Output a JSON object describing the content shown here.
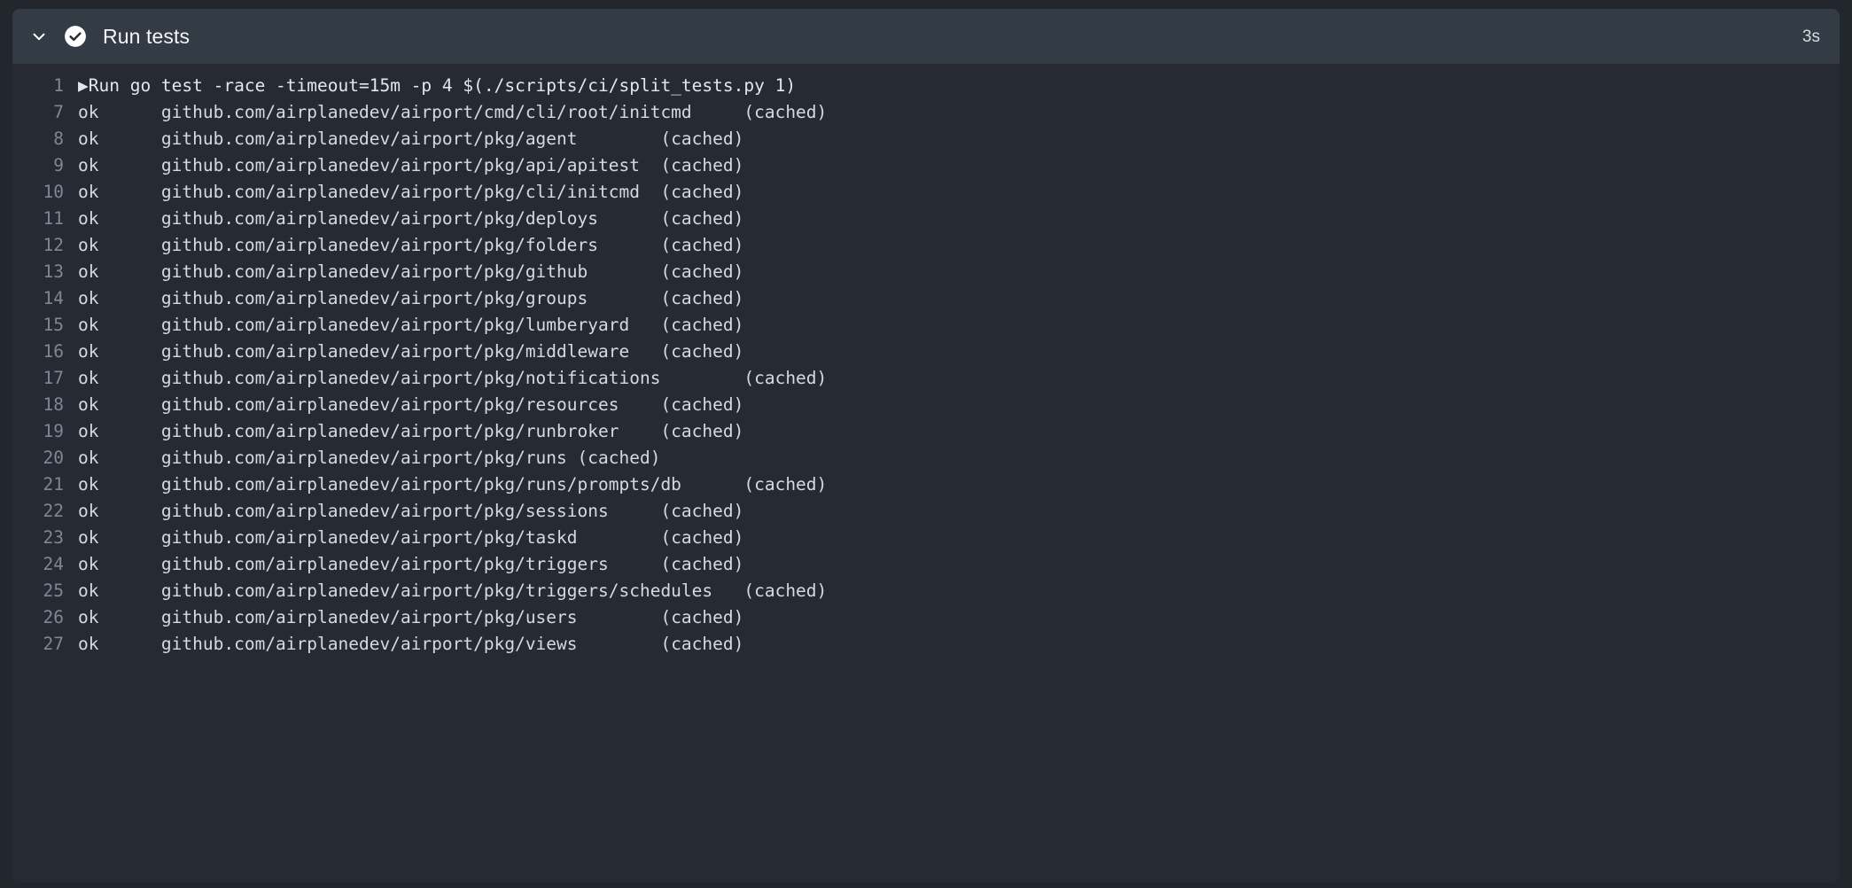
{
  "step": {
    "title": "Run tests",
    "duration": "3s",
    "status": "success",
    "collapse_icon": "chevron-down-icon",
    "status_icon": "check-circle-icon",
    "expanded": true
  },
  "colors": {
    "page_background": "#22262d",
    "header_background": "#333b45",
    "log_background": "#262b33",
    "text": "#d5dae1",
    "line_number": "#7d8795",
    "title": "#f3f5f7",
    "status_icon_fill": "#ffffff"
  },
  "log": {
    "lines": [
      {
        "number": "1",
        "text": "▶Run go test -race -timeout=15m -p 4 $(./scripts/ci/split_tests.py 1)",
        "type": "command"
      },
      {
        "number": "7",
        "text": "ok  \tgithub.com/airplanedev/airport/cmd/cli/root/initcmd\t(cached)",
        "type": "output"
      },
      {
        "number": "8",
        "text": "ok  \tgithub.com/airplanedev/airport/pkg/agent\t(cached)",
        "type": "output"
      },
      {
        "number": "9",
        "text": "ok  \tgithub.com/airplanedev/airport/pkg/api/apitest\t(cached)",
        "type": "output"
      },
      {
        "number": "10",
        "text": "ok  \tgithub.com/airplanedev/airport/pkg/cli/initcmd\t(cached)",
        "type": "output"
      },
      {
        "number": "11",
        "text": "ok  \tgithub.com/airplanedev/airport/pkg/deploys\t(cached)",
        "type": "output"
      },
      {
        "number": "12",
        "text": "ok  \tgithub.com/airplanedev/airport/pkg/folders\t(cached)",
        "type": "output"
      },
      {
        "number": "13",
        "text": "ok  \tgithub.com/airplanedev/airport/pkg/github\t(cached)",
        "type": "output"
      },
      {
        "number": "14",
        "text": "ok  \tgithub.com/airplanedev/airport/pkg/groups\t(cached)",
        "type": "output"
      },
      {
        "number": "15",
        "text": "ok  \tgithub.com/airplanedev/airport/pkg/lumberyard\t(cached)",
        "type": "output"
      },
      {
        "number": "16",
        "text": "ok  \tgithub.com/airplanedev/airport/pkg/middleware\t(cached)",
        "type": "output"
      },
      {
        "number": "17",
        "text": "ok  \tgithub.com/airplanedev/airport/pkg/notifications\t(cached)",
        "type": "output"
      },
      {
        "number": "18",
        "text": "ok  \tgithub.com/airplanedev/airport/pkg/resources\t(cached)",
        "type": "output"
      },
      {
        "number": "19",
        "text": "ok  \tgithub.com/airplanedev/airport/pkg/runbroker\t(cached)",
        "type": "output"
      },
      {
        "number": "20",
        "text": "ok  \tgithub.com/airplanedev/airport/pkg/runs\t(cached)",
        "type": "output"
      },
      {
        "number": "21",
        "text": "ok  \tgithub.com/airplanedev/airport/pkg/runs/prompts/db\t(cached)",
        "type": "output"
      },
      {
        "number": "22",
        "text": "ok  \tgithub.com/airplanedev/airport/pkg/sessions\t(cached)",
        "type": "output"
      },
      {
        "number": "23",
        "text": "ok  \tgithub.com/airplanedev/airport/pkg/taskd\t(cached)",
        "type": "output"
      },
      {
        "number": "24",
        "text": "ok  \tgithub.com/airplanedev/airport/pkg/triggers\t(cached)",
        "type": "output"
      },
      {
        "number": "25",
        "text": "ok  \tgithub.com/airplanedev/airport/pkg/triggers/schedules\t(cached)",
        "type": "output"
      },
      {
        "number": "26",
        "text": "ok  \tgithub.com/airplanedev/airport/pkg/users\t(cached)",
        "type": "output"
      },
      {
        "number": "27",
        "text": "ok  \tgithub.com/airplanedev/airport/pkg/views\t(cached)",
        "type": "output"
      }
    ]
  }
}
